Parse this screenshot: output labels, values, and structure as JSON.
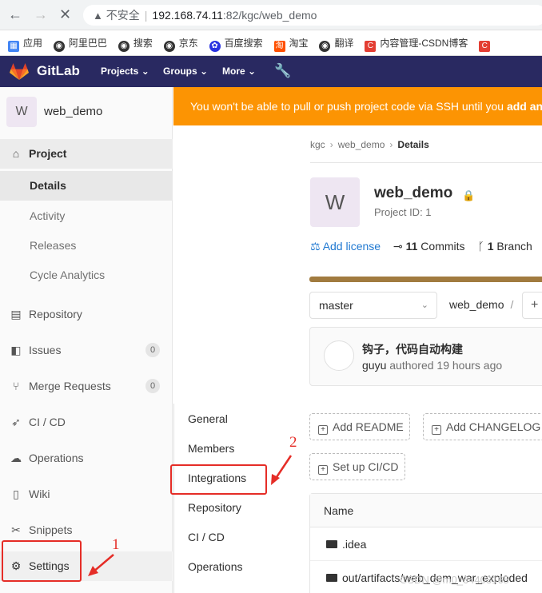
{
  "browser": {
    "not_secure": "不安全",
    "url_host": "192.168.74.11",
    "url_path": ":82/kgc/web_demo",
    "bookmarks": [
      "应用",
      "阿里巴巴",
      "搜索",
      "京东",
      "百度搜索",
      "淘宝",
      "翻译",
      "内容管理-CSDN博客"
    ]
  },
  "header": {
    "brand": "GitLab",
    "menus": [
      "Projects",
      "Groups",
      "More"
    ]
  },
  "sidebar": {
    "avatar_letter": "W",
    "project_name": "web_demo",
    "project_label": "Project",
    "project_subitems": [
      "Details",
      "Activity",
      "Releases",
      "Cycle Analytics"
    ],
    "items": [
      {
        "label": "Repository"
      },
      {
        "label": "Issues",
        "count": "0"
      },
      {
        "label": "Merge Requests",
        "count": "0"
      },
      {
        "label": "CI / CD"
      },
      {
        "label": "Operations"
      },
      {
        "label": "Wiki"
      },
      {
        "label": "Snippets"
      },
      {
        "label": "Settings"
      }
    ]
  },
  "settings_flyout": [
    "General",
    "Members",
    "Integrations",
    "Repository",
    "CI / CD",
    "Operations"
  ],
  "banner": {
    "text": "You won't be able to pull or push project code via SSH until you ",
    "bold": "add an"
  },
  "main": {
    "breadcrumbs": [
      "kgc",
      "web_demo",
      "Details"
    ],
    "avatar_letter": "W",
    "title": "web_demo",
    "project_id": "Project ID: 1",
    "add_license": "Add license",
    "commits_count": "11",
    "commits_label": "Commits",
    "branches_count": "1",
    "branches_label": "Branch",
    "branch": "master",
    "repo_name": "web_demo",
    "commit_title": "钩子，代码自动构建",
    "commit_author": "guyu",
    "commit_meta": "authored 19 hours ago",
    "buttons": [
      "Add README",
      "Add CHANGELOG",
      "Set up CI/CD"
    ],
    "files_header": "Name",
    "files": [
      ".idea",
      "out/artifacts/web_dem_war_exploded"
    ]
  },
  "annotations": {
    "num1": "1",
    "num2": "2"
  },
  "watermark": "CSDN @m0_64403165",
  "colors": {
    "header_bg": "#292961",
    "banner_bg": "#fc9403",
    "annotation": "#e52d27",
    "link": "#1f78d1"
  }
}
